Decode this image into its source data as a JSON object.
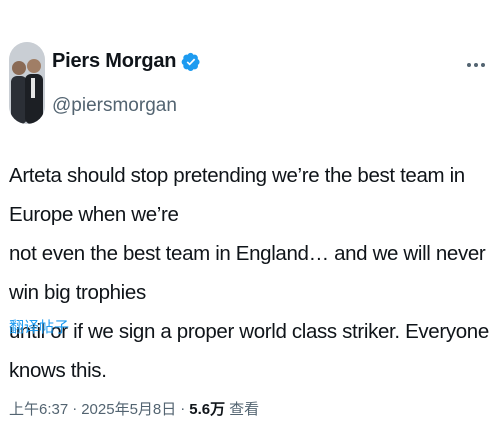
{
  "author": {
    "display_name": "Piers Morgan",
    "handle": "@piersmorgan",
    "verified": true
  },
  "colors": {
    "accent": "#1d9bf0",
    "secondary_text": "#536471",
    "primary_text": "#0f1419"
  },
  "icons": {
    "verified": "verified-badge-icon",
    "more": "more-options-icon"
  },
  "tweet": {
    "text": "Arteta should stop pretending we’re the best team in Europe when we’re\nnot even the best team in England… and we will never win big trophies\nuntil or if we sign a proper world class striker. Everyone knows this.",
    "translate_label": "翻译帖子",
    "time": "上午6:37",
    "date": "2025年5月8日",
    "separator": "·",
    "views_count": "5.6万",
    "views_label": "查看"
  }
}
